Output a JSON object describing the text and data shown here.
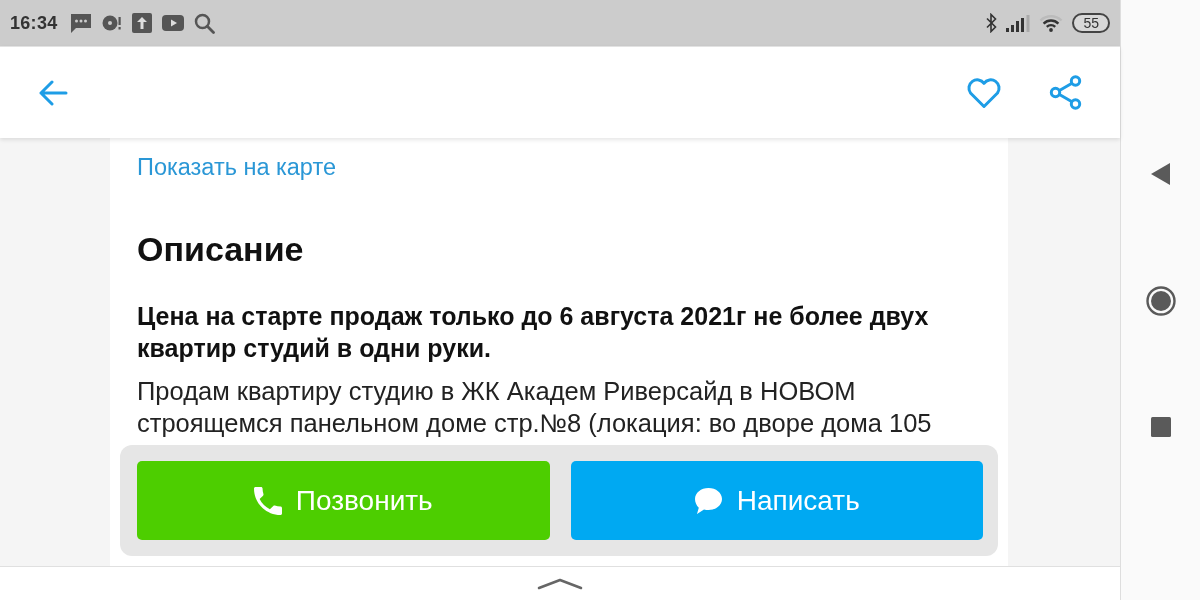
{
  "status_bar": {
    "time": "16:34",
    "battery": "55"
  },
  "header": {
    "favorite": false
  },
  "location": {
    "map_link": "Показать на карте"
  },
  "description": {
    "title": "Описание",
    "lead": "Цена на старте продаж только до 6 августа 2021г не более двух квартир студий в одни руки.",
    "text": "Продам квартиру студию в ЖК Академ Риверсайд в НОВОМ строящемся панельном доме стр.№8 (локация: во дворе дома 105"
  },
  "actions": [
    {
      "kind": "call",
      "label": "Позвонить"
    },
    {
      "kind": "message",
      "label": "Написать"
    }
  ]
}
